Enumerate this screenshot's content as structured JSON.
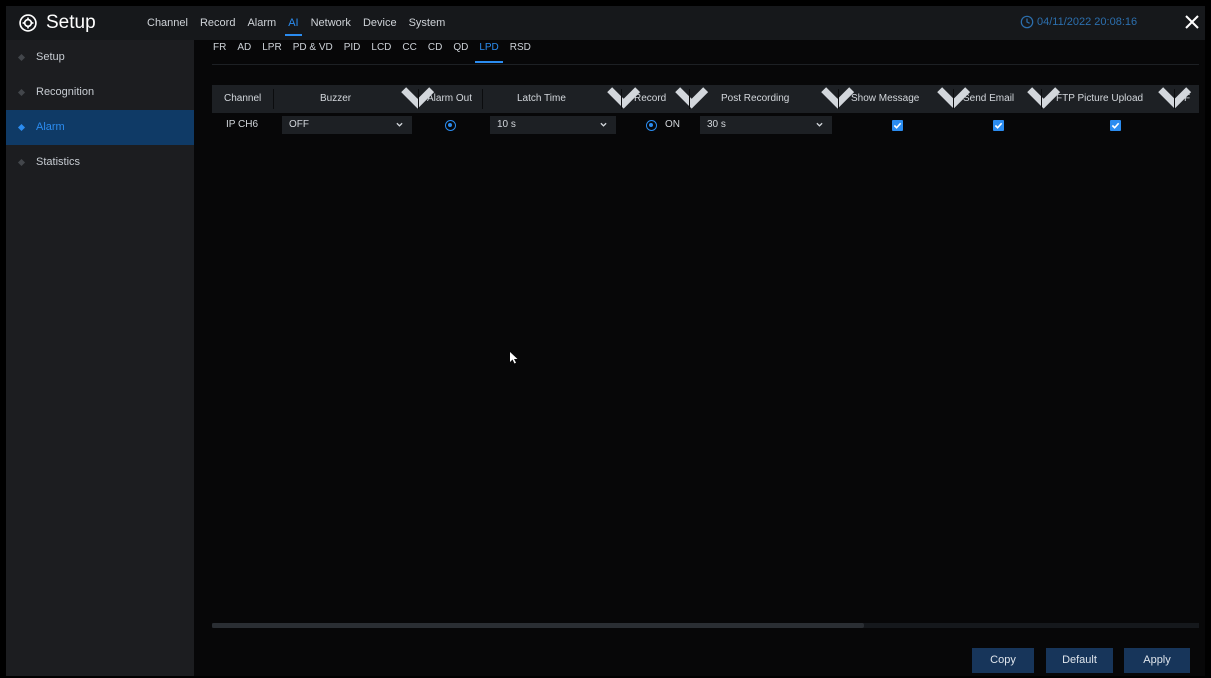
{
  "app": {
    "title": "Setup",
    "datetime": "04/11/2022 20:08:16"
  },
  "main_nav": [
    "Channel",
    "Record",
    "Alarm",
    "AI",
    "Network",
    "Device",
    "System"
  ],
  "main_nav_active": "AI",
  "sidebar": {
    "items": [
      "Setup",
      "Recognition",
      "Alarm",
      "Statistics"
    ],
    "active": "Alarm"
  },
  "subtabs": {
    "items": [
      "FR",
      "AD",
      "LPR",
      "PD & VD",
      "PID",
      "LCD",
      "CC",
      "CD",
      "QD",
      "LPD",
      "RSD"
    ],
    "active": "LPD"
  },
  "table": {
    "headers": {
      "channel": "Channel",
      "buzzer": "Buzzer",
      "alarm_out": "Alarm Out",
      "latch_time": "Latch Time",
      "record": "Record",
      "post_recording": "Post Recording",
      "show_message": "Show Message",
      "send_email": "Send Email",
      "ftp_upload": "FTP Picture Upload",
      "truncated": "F"
    },
    "rows": [
      {
        "channel": "IP CH6",
        "buzzer": "OFF",
        "latch_time": "10 s",
        "record": "ON",
        "post_recording": "30 s",
        "show_message": true,
        "send_email": true,
        "ftp_upload": true
      }
    ]
  },
  "buttons": {
    "copy": "Copy",
    "default": "Default",
    "apply": "Apply"
  },
  "colors": {
    "accent": "#2b8cf0",
    "sidebar_active_bg": "#0f3a66",
    "button_bg": "#17355a"
  }
}
